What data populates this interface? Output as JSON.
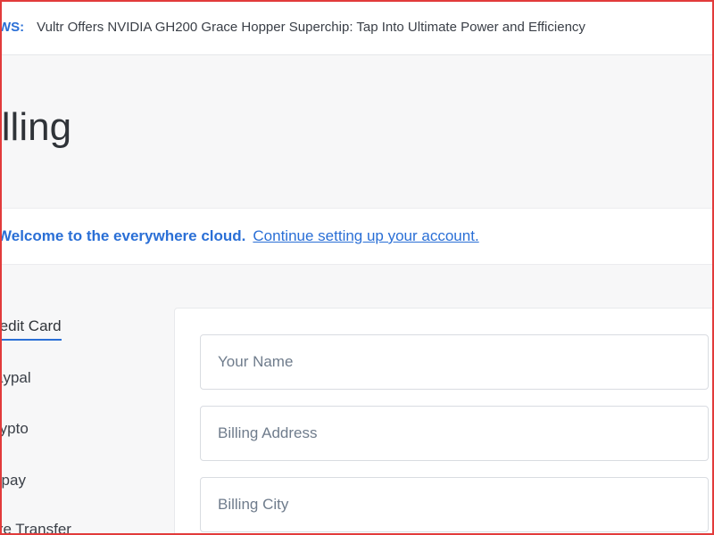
{
  "news": {
    "label": "WS:",
    "headline": "Vultr Offers NVIDIA GH200 Grace Hopper Superchip: Tap Into Ultimate Power and Efficiency"
  },
  "page": {
    "title": "illing"
  },
  "welcome": {
    "strong": "Welcome to the everywhere cloud.",
    "link": "Continue setting up your account."
  },
  "payment_tabs": [
    {
      "label": "redit Card",
      "active": true
    },
    {
      "label": "aypal",
      "active": false
    },
    {
      "label": "rypto",
      "active": false
    },
    {
      "label": "lipay",
      "active": false
    },
    {
      "label": "ire Transfer",
      "active": false
    }
  ],
  "form": {
    "name_placeholder": "Your Name",
    "address_placeholder": "Billing Address",
    "city_placeholder": "Billing City"
  },
  "colors": {
    "accent": "#2a6fd6",
    "frame": "#e23b3b"
  }
}
